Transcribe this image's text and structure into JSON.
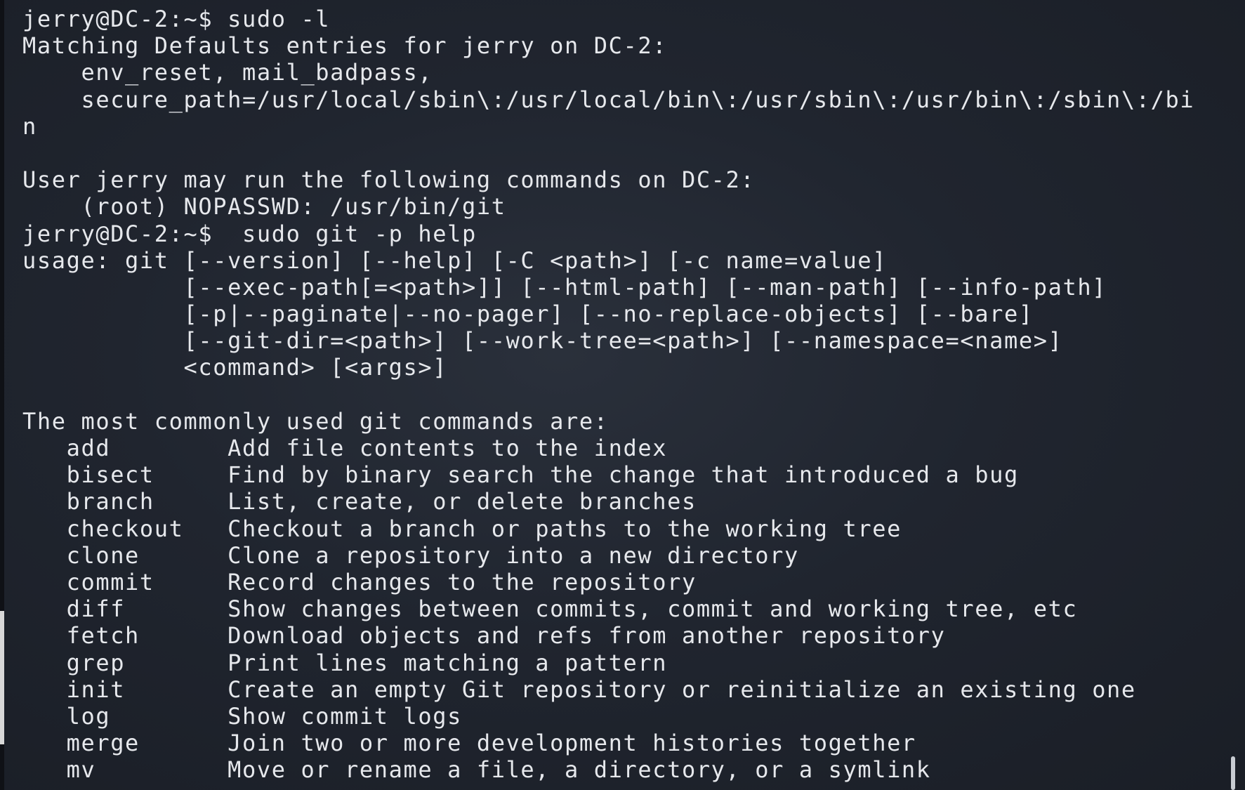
{
  "terminal": {
    "lines": [
      "jerry@DC-2:~$ sudo -l",
      "Matching Defaults entries for jerry on DC-2:",
      "    env_reset, mail_badpass,",
      "    secure_path=/usr/local/sbin\\:/usr/local/bin\\:/usr/sbin\\:/usr/bin\\:/sbin\\:/bi",
      "n",
      "",
      "User jerry may run the following commands on DC-2:",
      "    (root) NOPASSWD: /usr/bin/git",
      "jerry@DC-2:~$  sudo git -p help",
      "usage: git [--version] [--help] [-C <path>] [-c name=value]",
      "           [--exec-path[=<path>]] [--html-path] [--man-path] [--info-path]",
      "           [-p|--paginate|--no-pager] [--no-replace-objects] [--bare]",
      "           [--git-dir=<path>] [--work-tree=<path>] [--namespace=<name>]",
      "           <command> [<args>]",
      "",
      "The most commonly used git commands are:",
      "   add        Add file contents to the index",
      "   bisect     Find by binary search the change that introduced a bug",
      "   branch     List, create, or delete branches",
      "   checkout   Checkout a branch or paths to the working tree",
      "   clone      Clone a repository into a new directory",
      "   commit     Record changes to the repository",
      "   diff       Show changes between commits, commit and working tree, etc",
      "   fetch      Download objects and refs from another repository",
      "   grep       Print lines matching a pattern",
      "   init       Create an empty Git repository or reinitialize an existing one",
      "   log        Show commit logs",
      "   merge      Join two or more development histories together",
      "   mv         Move or rename a file, a directory, or a symlink"
    ]
  }
}
